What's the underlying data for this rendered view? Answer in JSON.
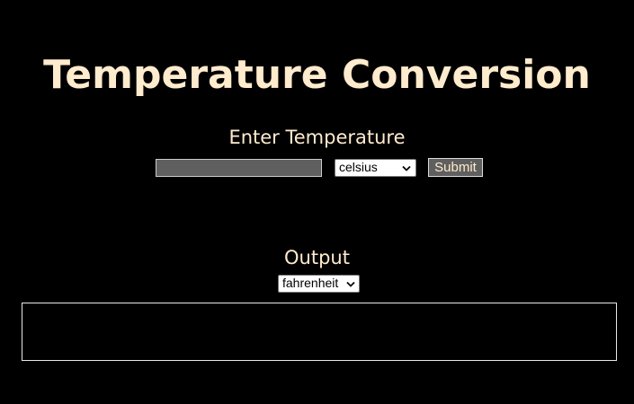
{
  "title": "Temperature Conversion",
  "input_section": {
    "heading": "Enter Temperature",
    "temperature_value": "",
    "from_unit": "celsius",
    "submit_label": "Submit"
  },
  "output_section": {
    "heading": "Output",
    "to_unit": "fahrenheit",
    "result": ""
  },
  "colors": {
    "background": "#000000",
    "accent_text": "#FFEBCD",
    "input_fill": "#5f5f5f"
  },
  "icons": {
    "dropdown": "chevron-down-icon"
  }
}
